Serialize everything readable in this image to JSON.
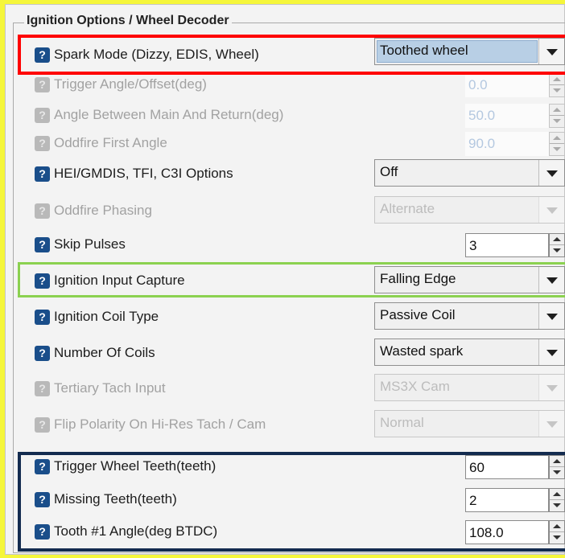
{
  "group_title": "Ignition Options / Wheel Decoder",
  "help_glyph": "?",
  "colors": {
    "highlight_red": "#ff0000",
    "highlight_green": "#8bd150",
    "highlight_navy": "#132b4f",
    "help_icon": "#1a4e8a",
    "page_background": "#f5f63a"
  },
  "rows": {
    "spark_mode": {
      "label": "Spark Mode (Dizzy, EDIS, Wheel)",
      "value": "Toothed wheel",
      "enabled": true
    },
    "trigger_angle": {
      "label": "Trigger Angle/Offset(deg)",
      "value": "0.0",
      "enabled": false
    },
    "angle_between": {
      "label": "Angle Between Main And Return(deg)",
      "value": "50.0",
      "enabled": false
    },
    "oddfire_first": {
      "label": "Oddfire First Angle",
      "value": "90.0",
      "enabled": false
    },
    "hei_options": {
      "label": "HEI/GMDIS, TFI, C3I Options",
      "value": "Off",
      "enabled": true
    },
    "oddfire_phasing": {
      "label": "Oddfire Phasing",
      "value": "Alternate",
      "enabled": false
    },
    "skip_pulses": {
      "label": "Skip Pulses",
      "value": "3",
      "enabled": true
    },
    "ignition_input_capture": {
      "label": "Ignition Input Capture",
      "value": "Falling Edge",
      "enabled": true
    },
    "ignition_coil_type": {
      "label": "Ignition Coil Type",
      "value": "Passive Coil",
      "enabled": true
    },
    "number_of_coils": {
      "label": "Number Of Coils",
      "value": "Wasted spark",
      "enabled": true
    },
    "tertiary_tach": {
      "label": "Tertiary Tach Input",
      "value": "MS3X Cam",
      "enabled": false
    },
    "flip_polarity": {
      "label": "Flip Polarity On Hi-Res Tach / Cam",
      "value": "Normal",
      "enabled": false
    },
    "trigger_wheel_teeth": {
      "label": "Trigger Wheel Teeth(teeth)",
      "value": "60",
      "enabled": true
    },
    "missing_teeth": {
      "label": "Missing Teeth(teeth)",
      "value": "2",
      "enabled": true
    },
    "tooth1_angle": {
      "label": "Tooth #1 Angle(deg BTDC)",
      "value": "108.0",
      "enabled": true
    }
  }
}
